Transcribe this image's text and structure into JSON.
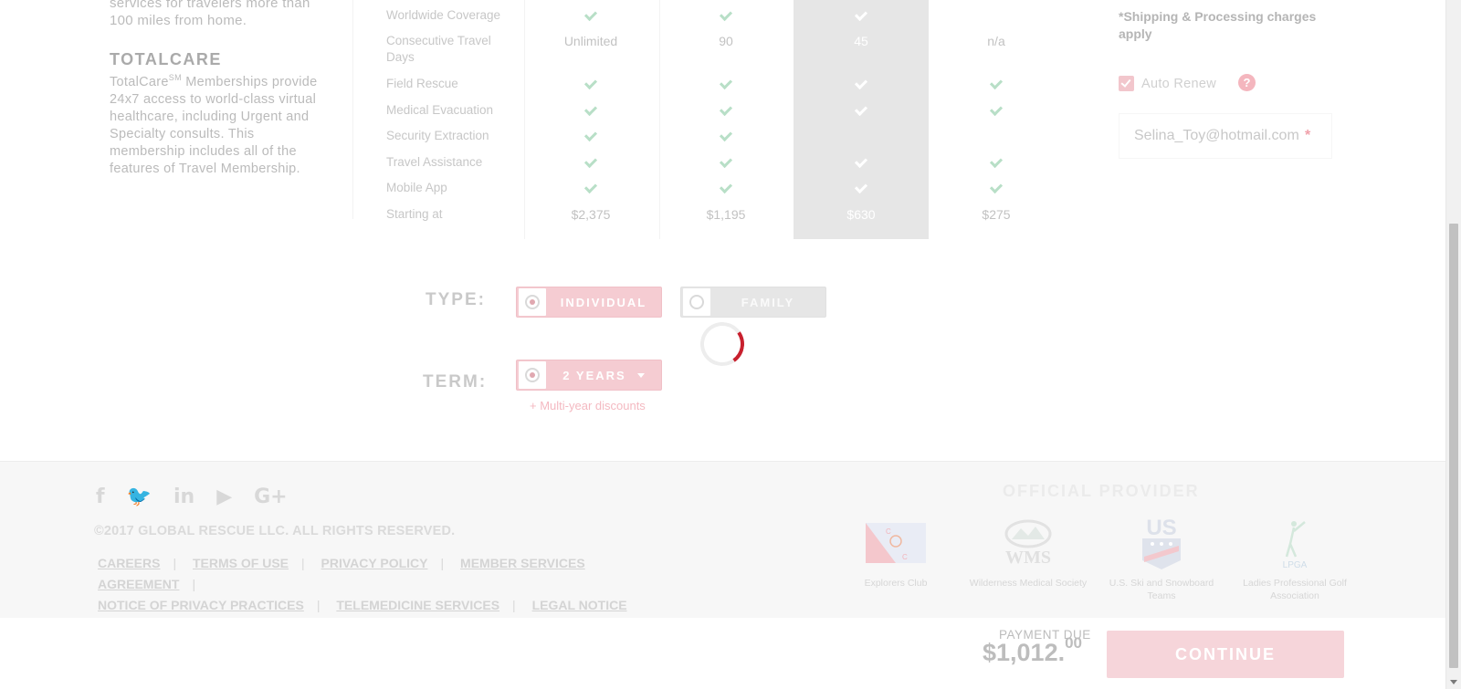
{
  "left": {
    "intro_text": "services for travelers more than 100 miles from home.",
    "totalcare_title": "TOTALCARE",
    "totalcare_desc_prefix": "TotalCare",
    "totalcare_sup": "SM",
    "totalcare_desc": " Memberships provide 24x7 access to world-class virtual healthcare, including Urgent and Specialty consults. This membership includes all of the features of Travel Membership."
  },
  "compare": {
    "rows": [
      {
        "feature": "Worldwide Coverage",
        "cells": [
          "check",
          "check",
          "check",
          ""
        ]
      },
      {
        "feature": "Consecutive Travel Days",
        "cells": [
          "Unlimited",
          "90",
          "45",
          "n/a"
        ]
      },
      {
        "feature": "Field Rescue",
        "cells": [
          "check",
          "check",
          "check",
          "check"
        ]
      },
      {
        "feature": "Medical Evacuation",
        "cells": [
          "check",
          "check",
          "check",
          "check"
        ]
      },
      {
        "feature": "Security Extraction",
        "cells": [
          "check",
          "check",
          "",
          ""
        ]
      },
      {
        "feature": "Travel Assistance",
        "cells": [
          "check",
          "check",
          "check",
          "check"
        ]
      },
      {
        "feature": "Mobile App",
        "cells": [
          "check",
          "check",
          "check",
          "check"
        ]
      },
      {
        "feature": "Starting at",
        "cells": [
          "$2,375",
          "$1,195",
          "$630",
          "$275"
        ]
      }
    ]
  },
  "right": {
    "shipping_note": "*Shipping & Processing charges apply",
    "auto_renew_label": "Auto Renew",
    "auto_renew_checked": true,
    "help_icon": "?",
    "email_value": "Selina_Toy@hotmail.com",
    "required_mark": "*"
  },
  "selector": {
    "type_label": "TYPE:",
    "type_options": [
      "INDIVIDUAL",
      "FAMILY"
    ],
    "type_selected": "INDIVIDUAL",
    "term_label": "TERM:",
    "term_value": "2 YEARS",
    "discount_link": "+ Multi-year discounts"
  },
  "footer": {
    "social_icons": [
      "facebook-icon",
      "twitter-icon",
      "linkedin-icon",
      "youtube-icon",
      "google-plus-icon"
    ],
    "copyright": "©2017 GLOBAL RESCUE LLC. ALL RIGHTS RESERVED.",
    "links": [
      "CAREERS",
      "TERMS OF USE",
      "PRIVACY POLICY",
      "MEMBER SERVICES AGREEMENT",
      "NOTICE OF PRIVACY PRACTICES",
      "TELEMEDICINE SERVICES",
      "LEGAL NOTICE"
    ],
    "provider_title": "OFFICIAL PROVIDER",
    "partners": [
      {
        "caption": "Explorers Club",
        "logo": "explorers-club-logo"
      },
      {
        "caption": "Wilderness Medical Society",
        "logo": "wms-logo",
        "logo_text": "WMS"
      },
      {
        "caption": "U.S. Ski and Snowboard Teams",
        "logo": "us-ski-logo",
        "logo_text": "US"
      },
      {
        "caption": "Ladies Professional Golf Association",
        "logo": "lpga-logo",
        "logo_text": "LPGA"
      }
    ]
  },
  "payment": {
    "label": "PAYMENT DUE",
    "amount": "$1,012.",
    "cents": "00",
    "continue_label": "CONTINUE"
  },
  "colors": {
    "accent": "#c8202e",
    "accent_faded": "#f5ccd2",
    "check_green": "#b8dfc7",
    "highlight_col": "#e6e6e6"
  }
}
